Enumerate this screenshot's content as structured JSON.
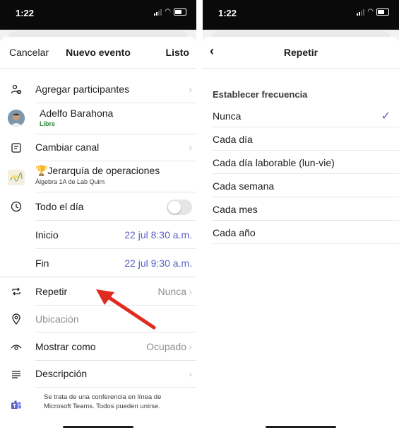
{
  "left": {
    "status": {
      "time": "1:22"
    },
    "nav": {
      "cancel": "Cancelar",
      "title": "Nuevo evento",
      "done": "Listo"
    },
    "add_participants": "Agregar participantes",
    "participant": {
      "name": "Adelfo Barahona",
      "status": "Libre"
    },
    "change_channel": "Cambiar canal",
    "channel": {
      "name": "🏆Jerarquía de operaciones",
      "sub": "Álgebra 1A de Lab Quim"
    },
    "all_day": "Todo el día",
    "start": {
      "label": "Inicio",
      "value": "22 jul 8:30 a.m."
    },
    "end": {
      "label": "Fin",
      "value": "22 jul 9:30 a.m."
    },
    "repeat": {
      "label": "Repetir",
      "value": "Nunca"
    },
    "location": "Ubicación",
    "show_as": {
      "label": "Mostrar como",
      "value": "Ocupado"
    },
    "description": "Descripción",
    "teams_note": {
      "line1": "Se trata de una conferencia en línea de",
      "line2": "Microsoft Teams. Todos pueden unirse."
    },
    "accent_color": "#5b5fc7",
    "arrow_color": "#e02b20"
  },
  "right": {
    "status": {
      "time": "1:22"
    },
    "nav": {
      "title": "Repetir"
    },
    "section": "Establecer frecuencia",
    "options": [
      "Nunca",
      "Cada día",
      "Cada día laborable (lun-vie)",
      "Cada semana",
      "Cada mes",
      "Cada año"
    ],
    "selected": "Nunca"
  }
}
